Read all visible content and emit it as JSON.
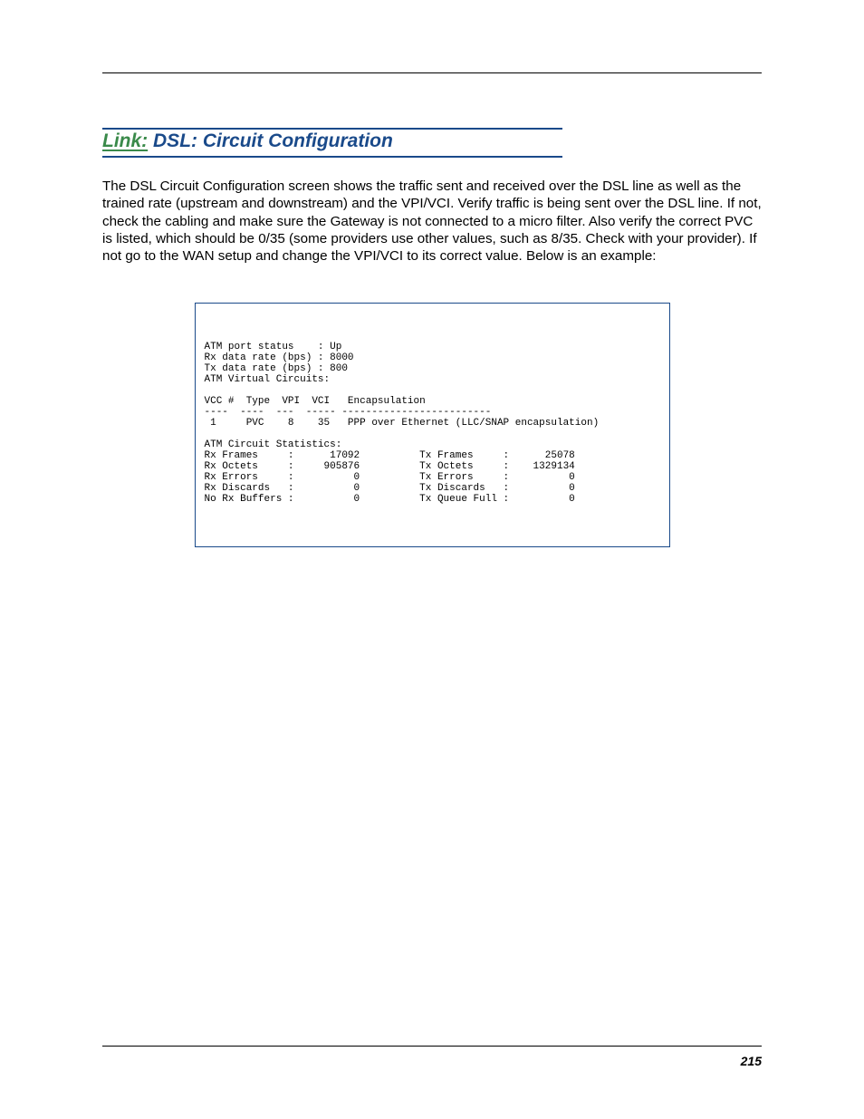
{
  "heading": {
    "link": "Link:",
    "title": "DSL: Circuit Configuration"
  },
  "paragraph": "The DSL Circuit Configuration screen shows the traffic sent and received over the DSL line as well as the trained rate (upstream and downstream) and the VPI/VCI. Verify traffic is being sent over the DSL line. If not, check the cabling and make sure the Gateway is not connected to a micro filter. Also verify the correct PVC is listed, which should be 0/35 (some providers use other values, such as 8/35. Check with your provider). If not go to the WAN setup and change the VPI/VCI to its correct value. Below is an example:",
  "terminal_text": "ATM port status    : Up\nRx data rate (bps) : 8000\nTx data rate (bps) : 800\nATM Virtual Circuits:\n\nVCC #  Type  VPI  VCI   Encapsulation\n----  ----  ---  ----- -------------------------\n 1     PVC    8    35   PPP over Ethernet (LLC/SNAP encapsulation)\n\nATM Circuit Statistics:\nRx Frames     :      17092          Tx Frames     :      25078\nRx Octets     :     905876          Tx Octets     :    1329134\nRx Errors     :          0          Tx Errors     :          0\nRx Discards   :          0          Tx Discards   :          0\nNo Rx Buffers :          0          Tx Queue Full :          0",
  "page_number": "215"
}
